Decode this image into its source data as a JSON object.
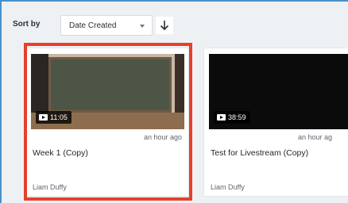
{
  "toolbar": {
    "sort_label": "Sort by",
    "sort_value": "Date Created",
    "sort_direction_icon": "arrow-down-icon"
  },
  "cards": [
    {
      "duration": "11:05",
      "time_ago": "an hour ago",
      "title": "Week 1 (Copy)",
      "author": "Liam Duffy",
      "selected": true
    },
    {
      "duration": "38:59",
      "time_ago": "an hour ag",
      "title": "Test for Livestream (Copy)",
      "author": "Liam Duffy",
      "selected": false
    }
  ],
  "colors": {
    "selection_outline": "#e5402b",
    "frame_accent": "#4a90c8",
    "background": "#eef1f4"
  }
}
